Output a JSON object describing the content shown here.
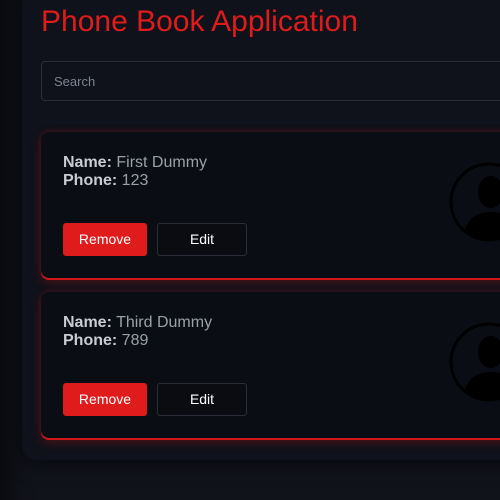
{
  "app": {
    "title": "Phone Book Application"
  },
  "search": {
    "placeholder": "Search",
    "value": ""
  },
  "contacts": [
    {
      "name_label": "Name:",
      "name": "First Dummy",
      "phone_label": "Phone:",
      "phone": "123",
      "remove_label": "Remove",
      "edit_label": "Edit",
      "avatar_icon": "user-silhouette-icon"
    },
    {
      "name_label": "Name:",
      "name": "Third Dummy",
      "phone_label": "Phone:",
      "phone": "789",
      "remove_label": "Remove",
      "edit_label": "Edit",
      "avatar_icon": "user-silhouette-icon"
    }
  ],
  "colors": {
    "accent": "#e01b1b",
    "background": "#0f121a",
    "card": "#0b0d14",
    "text_muted": "#9aa0aa"
  }
}
